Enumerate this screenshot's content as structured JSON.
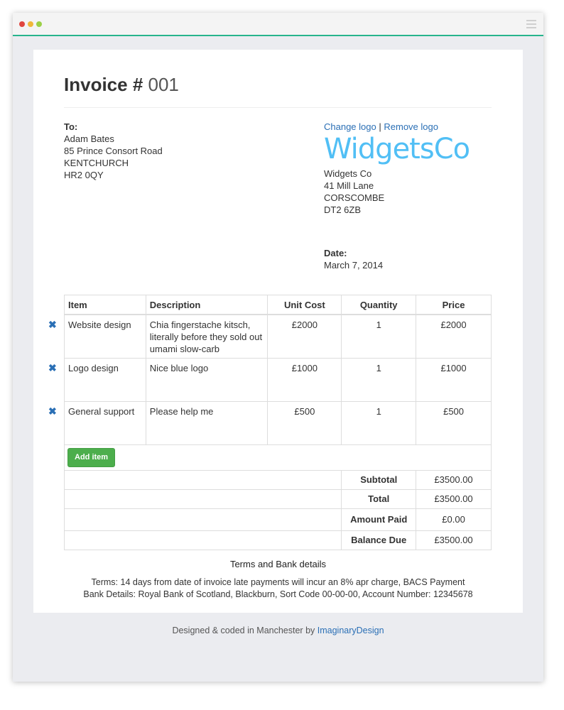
{
  "invoice": {
    "title_label": "Invoice #",
    "number": "001"
  },
  "to": {
    "label": "To:",
    "lines": [
      "Adam Bates",
      "85 Prince Consort Road",
      "KENTCHURCH",
      "HR2 0QY"
    ]
  },
  "logo": {
    "change_label": "Change logo",
    "separator": "|",
    "remove_label": "Remove logo",
    "text": "WidgetsCo",
    "color": "#51bff5"
  },
  "from": {
    "lines": [
      "Widgets Co",
      "41 Mill Lane",
      "CORSCOMBE",
      "DT2 6ZB"
    ]
  },
  "date": {
    "label": "Date:",
    "value": "March 7, 2014"
  },
  "table": {
    "headers": [
      "Item",
      "Description",
      "Unit Cost",
      "Quantity",
      "Price"
    ],
    "rows": [
      {
        "item": "Website design",
        "description": "Chia fingerstache kitsch, literally before they sold out umami slow-carb",
        "unit_cost": "£2000",
        "quantity": "1",
        "price": "£2000"
      },
      {
        "item": "Logo design",
        "description": "Nice blue logo",
        "unit_cost": "£1000",
        "quantity": "1",
        "price": "£1000"
      },
      {
        "item": "General support",
        "description": "Please help me",
        "unit_cost": "£500",
        "quantity": "1",
        "price": "£500"
      }
    ],
    "add_item_label": "Add item",
    "remove_icon": "x-icon"
  },
  "totals": {
    "subtotal_label": "Subtotal",
    "subtotal": "£3500.00",
    "total_label": "Total",
    "total": "£3500.00",
    "paid_label": "Amount Paid",
    "paid": "£0.00",
    "balance_label": "Balance Due",
    "balance": "£3500.00"
  },
  "terms": {
    "title": "Terms and Bank details",
    "line1": "Terms: 14 days from date of invoice late payments will incur an 8% apr charge, BACS Payment",
    "line2": "Bank Details: Royal Bank of Scotland, Blackburn, Sort Code 00-00-00, Account Number: 12345678"
  },
  "footer": {
    "prefix": "Designed & coded in Manchester by",
    "link": "ImaginaryDesign"
  },
  "colors": {
    "accent": "#27b48c",
    "link": "#2a6fb5",
    "button": "#4cae4c"
  }
}
